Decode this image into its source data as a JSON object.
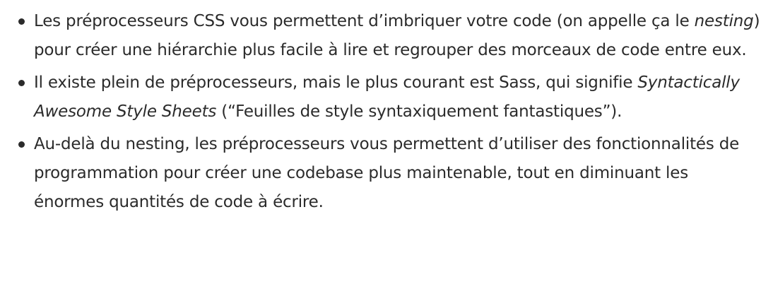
{
  "items": [
    {
      "t1": "Les préprocesseurs CSS vous permettent d’imbriquer votre code (on appelle ça le ",
      "em": "nesting",
      "t2": ") pour créer une hiérarchie plus facile à lire et regrouper des morceaux de code entre eux."
    },
    {
      "t1": "Il existe plein de préprocesseurs, mais le plus courant est Sass, qui signifie ",
      "em": "Syntactically Awesome Style Sheets",
      "t2": " (“Feuilles de style syntaxiquement fantastiques”)."
    },
    {
      "t1": "Au-delà du nesting, les préprocesseurs vous permettent d’utiliser des fonctionnalités de programmation pour créer une codebase plus maintenable, tout en diminuant les énormes quantités de code à écrire."
    }
  ]
}
